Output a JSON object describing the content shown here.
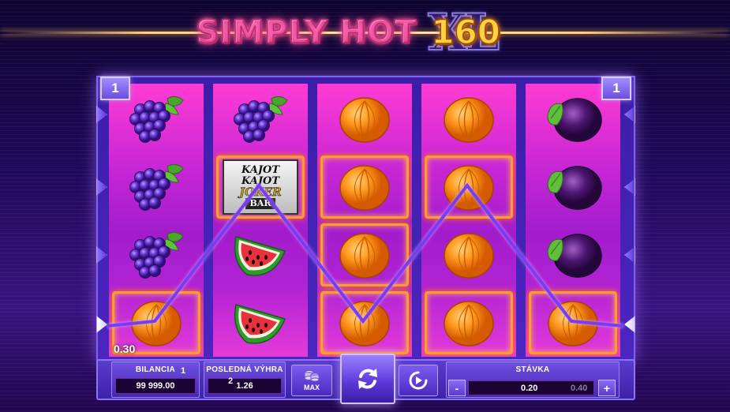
{
  "game": {
    "title_text": "SIMPLY HOT",
    "title_number": "160",
    "title_suffix": "XL"
  },
  "lines": {
    "left_badge": "1",
    "right_badge": "1"
  },
  "reels": [
    [
      "grapes",
      "grapes",
      "grapes",
      "orange"
    ],
    [
      "grapes",
      "joker-bar",
      "watermelon",
      "watermelon"
    ],
    [
      "orange",
      "orange",
      "orange",
      "orange"
    ],
    [
      "orange",
      "orange",
      "orange",
      "orange"
    ],
    [
      "plum",
      "plum",
      "plum",
      "orange"
    ]
  ],
  "winning_cells": [
    [
      0,
      3
    ],
    [
      1,
      1
    ],
    [
      2,
      1
    ],
    [
      2,
      2
    ],
    [
      2,
      3
    ],
    [
      3,
      1
    ],
    [
      3,
      3
    ],
    [
      4,
      3
    ]
  ],
  "payline_rows": [
    3,
    1,
    3,
    1,
    3
  ],
  "win": {
    "amount": "0.30"
  },
  "joker_symbol": {
    "line1": "KAJOT",
    "line2": "KAJOT",
    "line3": "JOKER",
    "line4": "BAR"
  },
  "panels": {
    "balance_label": "BILANCIA",
    "balance_marker": "1",
    "balance_value": "99 999.00",
    "last_win_label": "POSLEDNÁ VÝHRA",
    "last_win_marker": "2",
    "last_win_value": "1.26",
    "max_label": "MAX",
    "bet_label": "STÁVKA",
    "bet_value": "0.20",
    "bet_next_value": "0.40",
    "minus_label": "-",
    "plus_label": "+"
  },
  "icons": {
    "spin": "spin-refresh-icon",
    "autoplay": "autoplay-icon",
    "max_bet": "coin-stack-icon"
  },
  "colors": {
    "reel_pink": "#ff3bd4",
    "reel_purple": "#a21ccc",
    "frame": "#3b1ea8",
    "payline": "#7a3cf0",
    "win_glow": "#ff9b30",
    "title_gold": "#ffd33f"
  }
}
